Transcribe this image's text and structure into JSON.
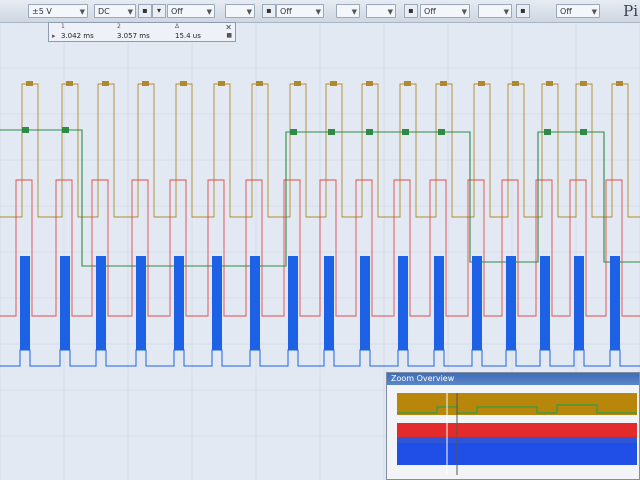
{
  "toolbar": {
    "range": "±5 V",
    "coupling": "DC",
    "trigger_a": "Off",
    "trigger_b": "Off",
    "trigger_c": "Off",
    "trigger_d": "Off",
    "brand": "Pi"
  },
  "ruler_table": {
    "col1": "1",
    "col2": "2",
    "col3": "Δ",
    "value1": "3.042 ms",
    "value2": "3.057 ms",
    "delta": "15.4 us"
  },
  "zoom_overview": {
    "title": "Zoom Overview"
  },
  "colors": {
    "channel_a": "#b08a2a",
    "channel_b": "#2f8a45",
    "channel_c": "#e04a4a",
    "channel_d": "#1d62e6",
    "grid": "#c7d2e2"
  }
}
